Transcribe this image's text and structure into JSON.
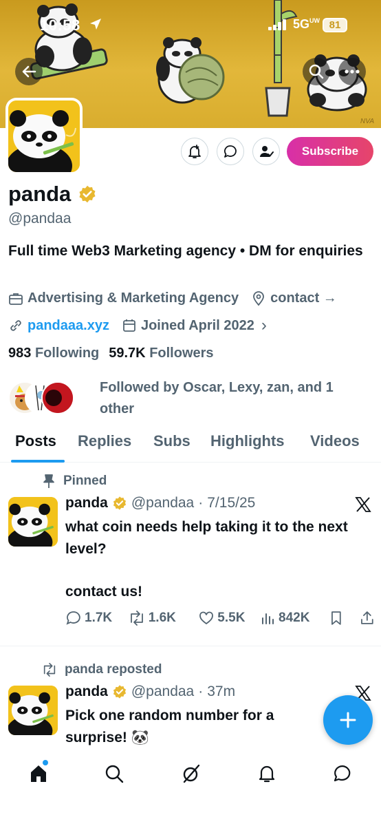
{
  "status_bar": {
    "time": "10:58",
    "network": "5G",
    "network_sup": "UW",
    "battery": "81"
  },
  "banner": {
    "watermark": "NVA"
  },
  "profile": {
    "subscribe_label": "Subscribe",
    "name": "panda",
    "handle": "@pandaa",
    "bio": "Full time Web3 Marketing agency • DM for enquiries",
    "category": "Advertising & Marketing Agency",
    "location": "contact",
    "location_arrow": "→",
    "website": "pandaaa.xyz",
    "joined": "Joined April 2022",
    "joined_chevron": "›",
    "following_count": "983",
    "following_label": "Following",
    "followers_count": "59.7K",
    "followers_label": "Followers",
    "followed_by": "Followed by Oscar, Lexy, zan, and 1 other"
  },
  "tabs": [
    "Posts",
    "Replies",
    "Subs",
    "Highlights",
    "Videos"
  ],
  "posts": [
    {
      "context": "Pinned",
      "name": "panda",
      "handle": "@pandaa",
      "sep": "·",
      "time": "7/15/25",
      "text_line1": "what coin needs help taking it to the next level?",
      "text_line2": "contact us!",
      "replies": "1.7K",
      "reposts": "1.6K",
      "likes": "5.5K",
      "views": "842K"
    },
    {
      "context": "panda reposted",
      "name": "panda",
      "handle": "@pandaa",
      "sep": "·",
      "time": "37m",
      "text_line1": "Pick one random number for a surprise! 🐼"
    }
  ],
  "colors": {
    "accent": "#1d9bf0",
    "banner": "#e2b73a",
    "verified": "#e8b830",
    "subscribe_start": "#d82fa8",
    "subscribe_end": "#e6456a"
  },
  "icons": [
    "back-arrow-icon",
    "search-icon",
    "more-icon",
    "notify-plus-icon",
    "message-icon",
    "follow-check-icon",
    "verified-badge-icon",
    "briefcase-icon",
    "location-pin-icon",
    "link-icon",
    "calendar-icon",
    "pin-icon",
    "repost-icon",
    "x-logo-icon",
    "reply-icon",
    "like-icon",
    "views-icon",
    "bookmark-icon",
    "share-icon",
    "plus-icon",
    "home-icon",
    "explore-icon",
    "grok-icon",
    "bell-icon",
    "chat-icon"
  ]
}
